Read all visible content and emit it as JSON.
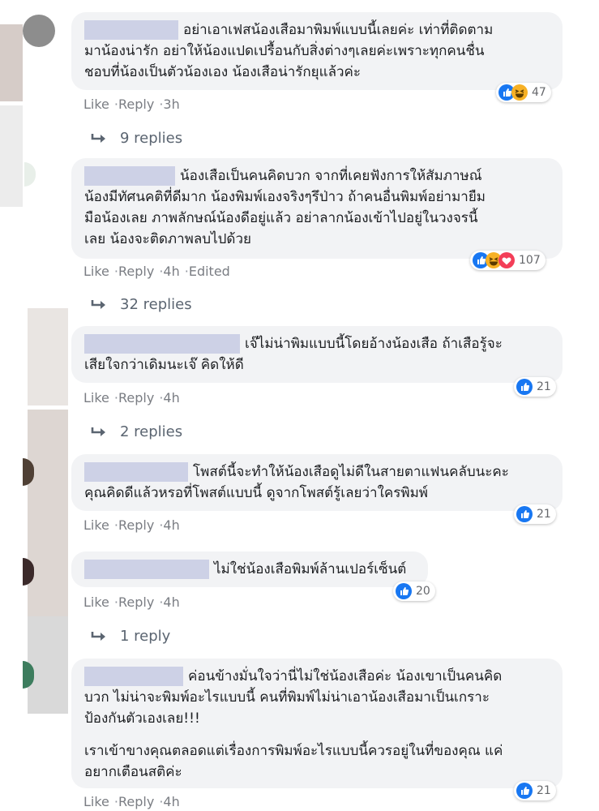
{
  "comments": [
    {
      "lines": [
        "อย่าเอาเฟสน้องเสือมาพิมพ์แบบนี้เลยค่ะ เท่าที่ติดตาม",
        "มาน้องน่ารัก อย่าให้น้องแปดเปรื้อนกับสิ่งต่างๆเลยค่ะเพราะทุกคนชื่น",
        "ชอบที่น้องเป็นตัวน้องเอง น้องเสือน่ารักยุแล้วค่ะ"
      ],
      "like": "Like",
      "reply": "Reply",
      "time": "3h",
      "edited": "",
      "reaction_count": "47",
      "reactions": [
        "like-icon",
        "haha-icon"
      ],
      "replies_label": "9 replies"
    },
    {
      "lines": [
        "น้องเสือเป็นคนคิดบวก จากที่เคยฟังการให้สัมภาษณ์",
        "น้องมีทัศนคติที่ดีมาก น้องพิมพ์เองจริงๆรึป่าว ถ้าคนอื่นพิมพ์อย่ามายืม",
        "มือน้องเลย ภาพลักษณ์น้องดีอยู่แล้ว อย่าลากน้องเข้าไปอยู่ในวงจรนี้",
        "เลย น้องจะติดภาพลบไปด้วย"
      ],
      "like": "Like",
      "reply": "Reply",
      "time": "4h",
      "edited": "Edited",
      "reaction_count": "107",
      "reactions": [
        "like-icon",
        "haha-icon",
        "love-icon"
      ],
      "replies_label": "32 replies"
    },
    {
      "lines": [
        "เจ๊ไม่น่าพิมแบบนี้โดยอ้างน้องเสือ ถ้าเสือรู้จะ",
        "เสียใจกว่าเดิมนะเจ๊ คิดให้ดี"
      ],
      "like": "Like",
      "reply": "Reply",
      "time": "4h",
      "edited": "",
      "reaction_count": "21",
      "reactions": [
        "like-icon"
      ],
      "replies_label": "2 replies"
    },
    {
      "lines": [
        "โพสต์นี้จะทำให้น้องเสือดูไม่ดีในสายตาแฟนคลับนะคะ",
        "คุณคิดดีแล้วหรอที่โพสต์แบบนี้ ดูจากโพสต์รู้เลยว่าใครพิมพ์"
      ],
      "like": "Like",
      "reply": "Reply",
      "time": "4h",
      "edited": "",
      "reaction_count": "21",
      "reactions": [
        "like-icon"
      ],
      "replies_label": ""
    },
    {
      "lines": [
        "ไม่ใช่น้องเสือพิมพ์ล้านเปอร์เซ็นต์"
      ],
      "like": "Like",
      "reply": "Reply",
      "time": "4h",
      "edited": "",
      "reaction_count": "20",
      "reactions": [
        "like-icon"
      ],
      "replies_label": "1 reply"
    },
    {
      "lines": [
        "ค่อนข้างมั่นใจว่านี่ไม่ใช่น้องเสือค่ะ น้องเขาเป็นคนคิด",
        "บวก ไม่น่าจะพิมพ์อะไรแบบนี้ คนที่พิมพ์ไม่น่าเอาน้องเสือมาเป็นเกราะ",
        "ป้องกันตัวเองเลย!!!"
      ],
      "lines2": [
        "เราเข้าขางคุณตลอดแต่เรื่องการพิมพ์อะไรแบบนี้ควรอยู่ในที่ของคุณ แค่",
        "อยากเตือนสติค่ะ"
      ],
      "like": "Like",
      "reply": "Reply",
      "time": "4h",
      "edited": "",
      "reaction_count": "21",
      "reactions": [
        "like-icon"
      ],
      "replies_label": ""
    }
  ],
  "colors": {
    "bubble": "#f2f3f5",
    "redaction": "#cdd1e6",
    "like_blue": "#1877f2",
    "haha_yellow": "#f7b125",
    "love_red": "#f33e58"
  }
}
